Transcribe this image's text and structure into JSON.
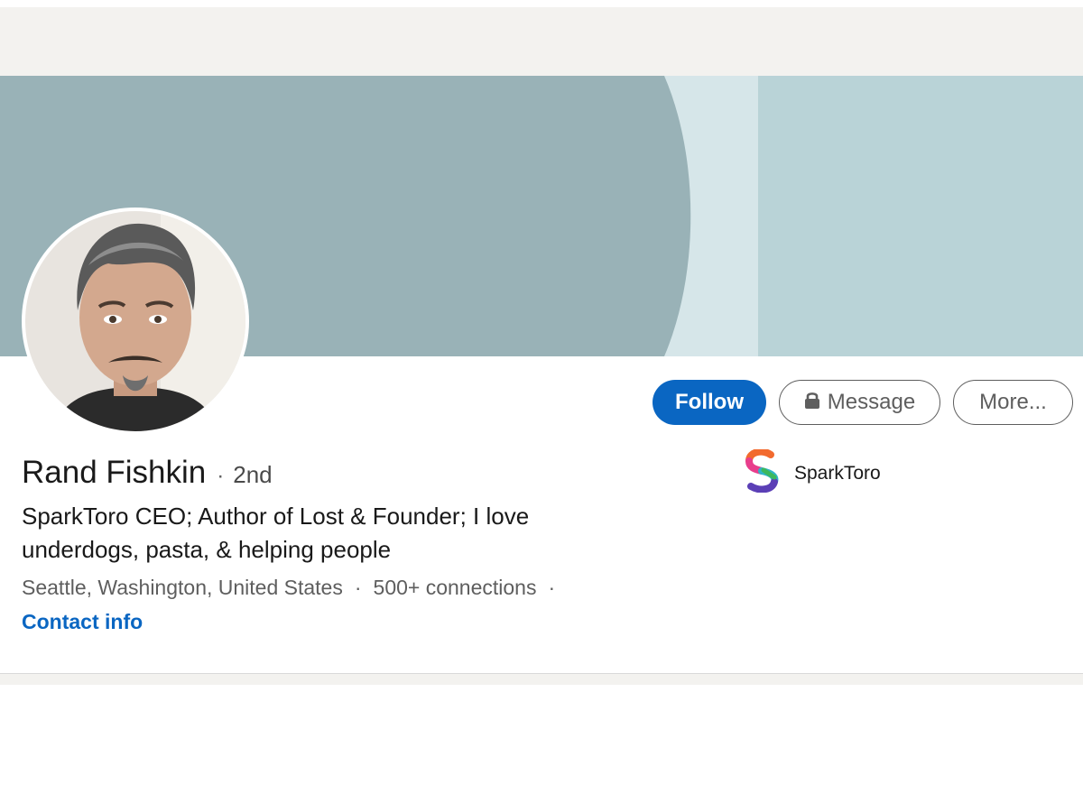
{
  "profile": {
    "name": "Rand Fishkin",
    "separator": "·",
    "degree": "2nd",
    "headline": "SparkToro CEO; Author of Lost & Founder; I love underdogs, pasta, & helping people",
    "location": "Seattle, Washington, United States",
    "connections": "500+ connections",
    "contact_label": "Contact info"
  },
  "actions": {
    "follow_label": "Follow",
    "message_label": "Message",
    "more_label": "More..."
  },
  "company": {
    "name": "SparkToro"
  },
  "icons": {
    "lock": "lock-icon",
    "company_logo": "sparktoro-logo"
  },
  "colors": {
    "accent": "#0a66c2",
    "banner_dark": "#99b2b7",
    "banner_light": "#b9d3d7",
    "banner_stripe": "#d6e6e9",
    "page_bg": "#f3f2ef"
  }
}
